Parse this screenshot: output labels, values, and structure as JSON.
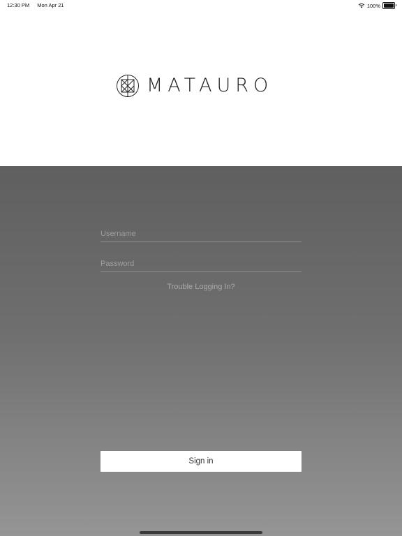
{
  "status_bar": {
    "time": "12:30 PM",
    "date": "Mon Apr 21",
    "battery": "100%",
    "wifi_icon": "wifi-icon",
    "battery_icon": "battery-icon"
  },
  "logo": {
    "text": "MATAURO",
    "icon": "mauro-logo-mark-icon"
  },
  "login": {
    "username_placeholder": "Username",
    "password_placeholder": "Password",
    "trouble_label": "Trouble Logging In?",
    "sign_in_label": "Sign in"
  },
  "colors": {
    "panel_top": "#5f5f5f",
    "panel_bottom": "#959595",
    "button_bg": "#ffffff"
  }
}
